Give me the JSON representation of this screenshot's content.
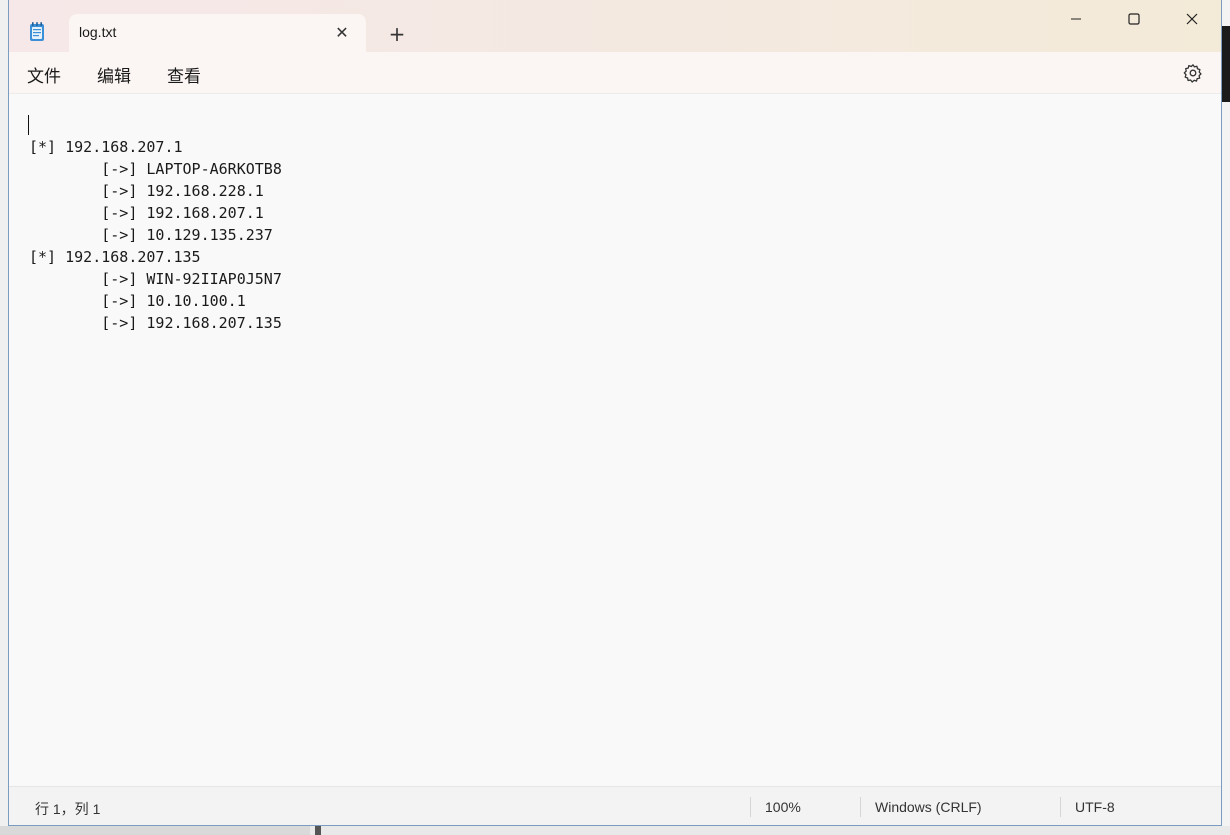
{
  "window": {
    "tab_title": "log.txt",
    "tab_close_glyph": "✕",
    "new_tab_glyph": "+",
    "icons": {
      "app": "notepad-icon",
      "minimize": "minimize-icon",
      "maximize": "maximize-icon",
      "close": "close-icon",
      "settings": "gear-icon"
    }
  },
  "menu": {
    "items": [
      {
        "label": "文件"
      },
      {
        "label": "编辑"
      },
      {
        "label": "查看"
      }
    ]
  },
  "editor": {
    "lines": [
      "",
      "[*] 192.168.207.1",
      "        [->] LAPTOP-A6RKOTB8",
      "        [->] 192.168.228.1",
      "        [->] 192.168.207.1",
      "        [->] 10.129.135.237",
      "[*] 192.168.207.135",
      "        [->] WIN-92IIAP0J5N7",
      "        [->] 10.10.100.1",
      "        [->] 192.168.207.135"
    ]
  },
  "status": {
    "position": "行 1，列 1",
    "zoom": "100%",
    "line_ending": "Windows (CRLF)",
    "encoding": "UTF-8"
  },
  "colors": {
    "titlebar_start": "#f6e8e8",
    "titlebar_end": "#f3ead8",
    "editor_bg": "#f9f9f9",
    "window_border": "#7a9cc0"
  }
}
